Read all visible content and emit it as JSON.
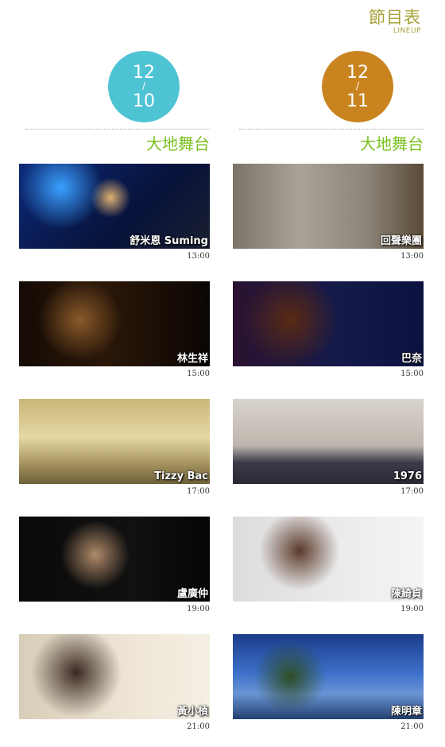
{
  "header": {
    "title": "節目表",
    "subtitle": "LINEUP"
  },
  "colors": {
    "accent_text": "#a8a23a",
    "stage_green": "#7bbf1e",
    "date1": "#4ec3d4",
    "date2": "#c9841f"
  },
  "columns": [
    {
      "date": {
        "month": "12",
        "slash": "/",
        "day": "10",
        "color": "#4ec3d4"
      },
      "stage": "大地舞台",
      "performers": [
        {
          "name": "舒米恩 Suming",
          "time": "13:00"
        },
        {
          "name": "林生祥",
          "time": "15:00"
        },
        {
          "name": "Tizzy Bac",
          "time": "17:00"
        },
        {
          "name": "盧廣仲",
          "time": "19:00"
        },
        {
          "name": "黃小楨",
          "time": "21:00"
        }
      ]
    },
    {
      "date": {
        "month": "12",
        "slash": "/",
        "day": "11",
        "color": "#c9841f"
      },
      "stage": "大地舞台",
      "performers": [
        {
          "name": "回聲樂團",
          "time": "13:00"
        },
        {
          "name": "巴奈",
          "time": "15:00"
        },
        {
          "name": "1976",
          "time": "17:00"
        },
        {
          "name": "陳綺貞",
          "time": "19:00"
        },
        {
          "name": "陳明章",
          "time": "21:00"
        }
      ]
    }
  ]
}
